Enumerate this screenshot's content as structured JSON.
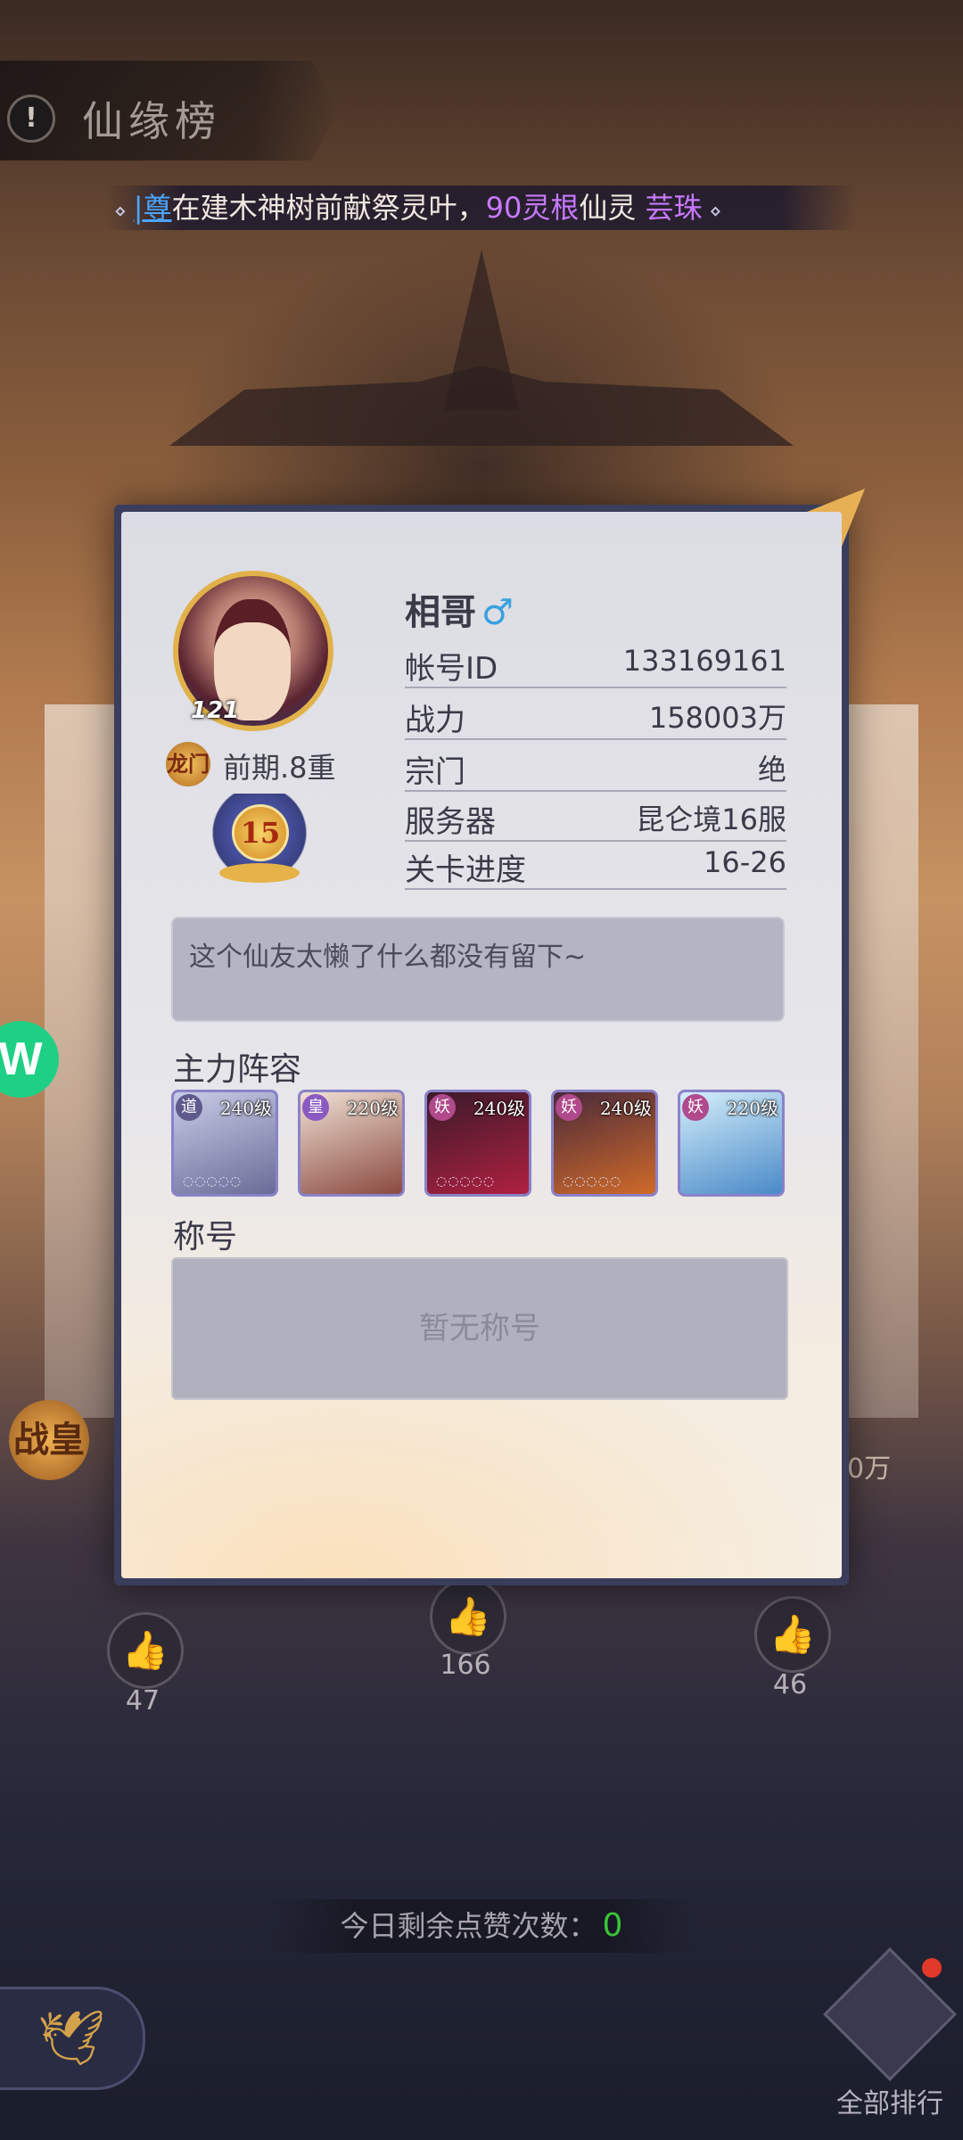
{
  "header": {
    "title": "仙缘榜",
    "icon": "exclamation-icon"
  },
  "ticker": {
    "prefix": "⋄",
    "name_fragment": "|尊",
    "text1": "在建木神树前献祭灵叶，",
    "highlight": "90灵根",
    "text2": "仙灵 ",
    "target": "芸珠",
    "suffix": "⋄"
  },
  "profile": {
    "name": "相哥",
    "gender_symbol": "♂",
    "avatar_level": "121",
    "dragon_badge": "龙门",
    "realm": "前期.8重",
    "emblem_level": "15",
    "rows": [
      {
        "label": "帐号ID",
        "value": "133169161"
      },
      {
        "label": "战力",
        "value": "158003万"
      },
      {
        "label": "宗门",
        "value": "绝"
      },
      {
        "label": "服务器",
        "value": "昆仑境16服"
      },
      {
        "label": "关卡进度",
        "value": "16-26"
      }
    ],
    "signature": "这个仙友太懒了什么都没有留下~"
  },
  "lineup": {
    "title": "主力阵容",
    "heroes": [
      {
        "tag": "道",
        "level": "240级",
        "stars": "◌◌◌◌◌",
        "tag_color": "#5e5a8c",
        "bg": "#9aa0c0"
      },
      {
        "tag": "皇",
        "level": "220级",
        "stars": "",
        "tag_color": "#8a5ac0",
        "bg": "#d6b8a8"
      },
      {
        "tag": "妖",
        "level": "240级",
        "stars": "◌◌◌◌◌",
        "tag_color": "#b04a8c",
        "bg": "#5a2030"
      },
      {
        "tag": "妖",
        "level": "240级",
        "stars": "◌◌◌◌◌",
        "tag_color": "#b04a8c",
        "bg": "#8a3a2a"
      },
      {
        "tag": "妖",
        "level": "220级",
        "stars": "",
        "tag_color": "#b04a8c",
        "bg": "#7ac0e8"
      }
    ]
  },
  "titles": {
    "heading": "称号",
    "empty": "暂无称号"
  },
  "background": {
    "side_badge": "战皇",
    "right_power_suffix": "0万",
    "likes": [
      "47",
      "166",
      "46"
    ],
    "likes_remaining_label": "今日剩余点赞次数：",
    "likes_remaining_value": "0",
    "rank_button": "全部排行",
    "float_badge": "W"
  }
}
